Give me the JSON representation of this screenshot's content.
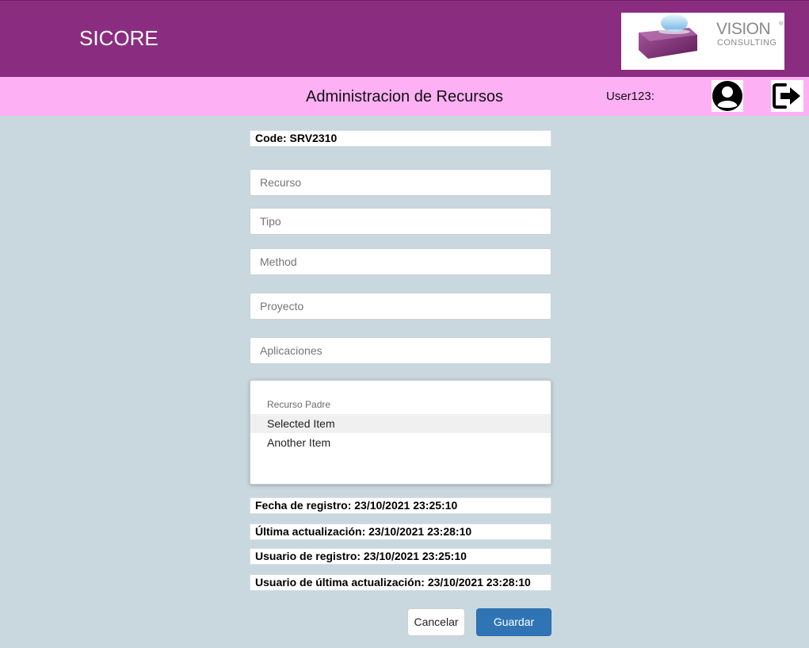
{
  "app": {
    "title": "SICORE",
    "logo_text": "VISION",
    "logo_sub": "CONSULTING",
    "logo_reg": "®"
  },
  "subbar": {
    "page_title": "Administracion de Recursos",
    "user_label": "User123:"
  },
  "form": {
    "code": "Code: SRV2310",
    "recurso_placeholder": "Recurso",
    "tipo_placeholder": "Tipo",
    "method_placeholder": "Method",
    "proyecto_placeholder": "Proyecto",
    "aplicaciones_placeholder": "Aplicaciones",
    "recurso_padre": {
      "label": "Recurso Padre",
      "items": [
        "Selected Item",
        "Another Item"
      ],
      "selected": "Selected Item"
    },
    "fecha_registro": "Fecha de registro: 23/10/2021 23:25:10",
    "ultima_actualizacion": "Última actualización: 23/10/2021 23:28:10",
    "usuario_registro": "Usuario de registro: 23/10/2021 23:25:10",
    "usuario_ultima_actualizacion": "Usuario de última actualización: 23/10/2021 23:28:10"
  },
  "buttons": {
    "cancel_label": "Cancelar",
    "save_label": "Guardar"
  },
  "icons": {
    "avatar": "user-circle-icon",
    "logout": "logout-icon"
  },
  "colors": {
    "header": "#8a2d80",
    "subbar": "#fdb0f4",
    "background": "#c9d8de",
    "primary_button": "#2f75b6"
  }
}
